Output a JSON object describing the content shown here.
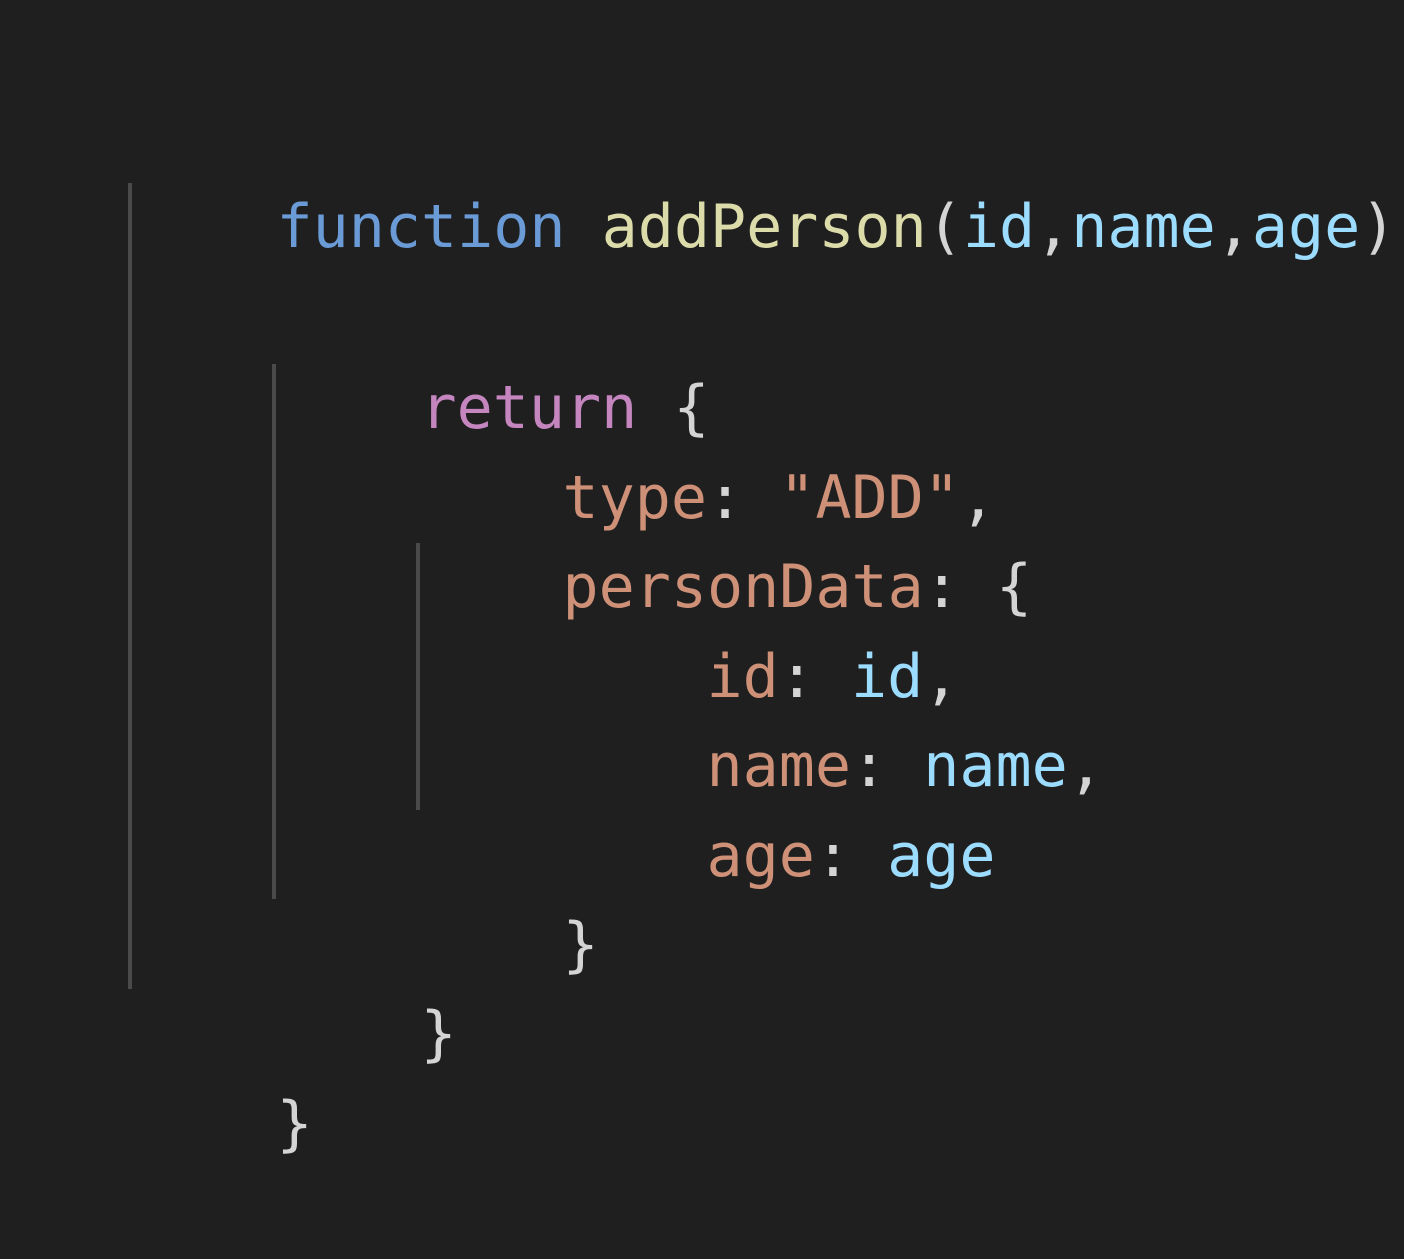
{
  "colors": {
    "background": "#1f1f1f",
    "keyword_storage": "#6a9bd6",
    "keyword_control": "#c586c0",
    "function_name": "#dcdcaa",
    "parameter": "#9cdcfe",
    "property": "#ce9178",
    "string": "#ce9178",
    "punctuation": "#d4d4d4",
    "indent_guide": "#4a4a4a"
  },
  "code": {
    "line1": {
      "keyword": "function",
      "space": " ",
      "fn_name": "addPerson",
      "open_paren": "(",
      "param1": "id",
      "comma1": ",",
      "param2": "name",
      "comma2": ",",
      "param3": "age",
      "close_paren": ")",
      "brace": " {"
    },
    "line3": {
      "keyword": "return",
      "brace": " {"
    },
    "line4": {
      "key": "type",
      "colon": ": ",
      "value": "\"ADD\"",
      "comma": ","
    },
    "line5": {
      "key": "personData",
      "colon": ": ",
      "brace": "{"
    },
    "line6": {
      "key": "id",
      "colon": ": ",
      "value": "id",
      "comma": ","
    },
    "line7": {
      "key": "name",
      "colon": ": ",
      "value": "name",
      "comma": ","
    },
    "line8": {
      "key": "age",
      "colon": ": ",
      "value": "age"
    },
    "line9": {
      "brace": "}"
    },
    "line10": {
      "brace": "}"
    },
    "line11": {
      "brace": "}"
    }
  }
}
